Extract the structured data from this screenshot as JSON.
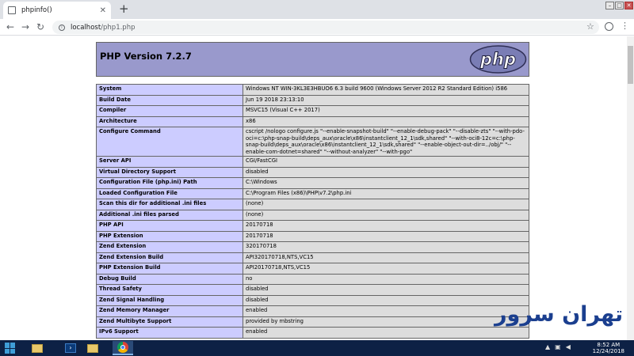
{
  "browser": {
    "tab_title": "phpinfo()",
    "new_tab": "+",
    "url_host": "localhost",
    "url_path": "/php1.php"
  },
  "page": {
    "title": "PHP Version 7.2.7",
    "logo_text": "php",
    "rows": [
      [
        "System",
        "Windows NT WIN-3KL3E3HBUO6 6.3 build 9600 (Windows Server 2012 R2 Standard Edition) i586"
      ],
      [
        "Build Date",
        "Jun 19 2018 23:13:10"
      ],
      [
        "Compiler",
        "MSVC15 (Visual C++ 2017)"
      ],
      [
        "Architecture",
        "x86"
      ],
      [
        "Configure Command",
        "cscript /nologo configure.js \"--enable-snapshot-build\" \"--enable-debug-pack\" \"--disable-zts\" \"--with-pdo-oci=c:\\php-snap-build\\deps_aux\\oracle\\x86\\instantclient_12_1\\sdk,shared\" \"--with-oci8-12c=c:\\php-snap-build\\deps_aux\\oracle\\x86\\instantclient_12_1\\sdk,shared\" \"--enable-object-out-dir=../obj/\" \"--enable-com-dotnet=shared\" \"--without-analyzer\" \"--with-pgo\""
      ],
      [
        "Server API",
        "CGI/FastCGI"
      ],
      [
        "Virtual Directory Support",
        "disabled"
      ],
      [
        "Configuration File (php.ini) Path",
        "C:\\Windows"
      ],
      [
        "Loaded Configuration File",
        "C:\\Program Files (x86)\\PHP\\v7.2\\php.ini"
      ],
      [
        "Scan this dir for additional .ini files",
        "(none)"
      ],
      [
        "Additional .ini files parsed",
        "(none)"
      ],
      [
        "PHP API",
        "20170718"
      ],
      [
        "PHP Extension",
        "20170718"
      ],
      [
        "Zend Extension",
        "320170718"
      ],
      [
        "Zend Extension Build",
        "API320170718,NTS,VC15"
      ],
      [
        "PHP Extension Build",
        "API20170718,NTS,VC15"
      ],
      [
        "Debug Build",
        "no"
      ],
      [
        "Thread Safety",
        "disabled"
      ],
      [
        "Zend Signal Handling",
        "disabled"
      ],
      [
        "Zend Memory Manager",
        "enabled"
      ],
      [
        "Zend Multibyte Support",
        "provided by mbstring"
      ],
      [
        "IPv6 Support",
        "enabled"
      ]
    ]
  },
  "watermark": "تهران سرور",
  "taskbar": {
    "time": "8:52 AM",
    "date": "12/24/2018"
  },
  "colors": {
    "header_bg": "#9999cc",
    "key_bg": "#ccccff",
    "value_bg": "#dddddd",
    "taskbar_bg": "#0d2145"
  }
}
